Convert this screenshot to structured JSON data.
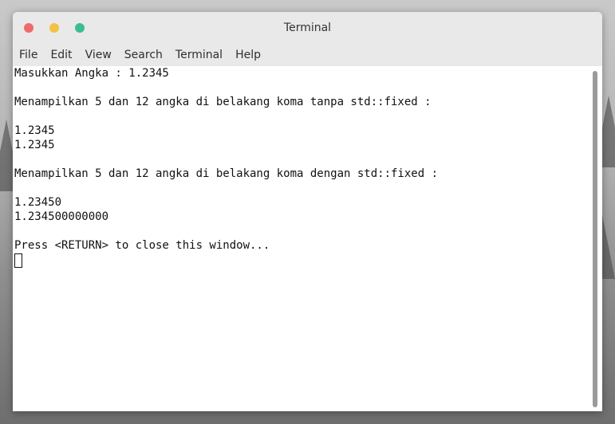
{
  "window": {
    "title": "Terminal"
  },
  "menu": {
    "items": [
      "File",
      "Edit",
      "View",
      "Search",
      "Terminal",
      "Help"
    ]
  },
  "terminal": {
    "lines": [
      "Masukkan Angka : 1.2345",
      "",
      "Menampilkan 5 dan 12 angka di belakang koma tanpa std::fixed :",
      "",
      "1.2345",
      "1.2345",
      "",
      "Menampilkan 5 dan 12 angka di belakang koma dengan std::fixed :",
      "",
      "1.23450",
      "1.234500000000",
      "",
      "Press <RETURN> to close this window..."
    ]
  },
  "icons": {
    "close": "close-icon",
    "minimize": "minimize-icon",
    "maximize": "maximize-icon"
  },
  "colors": {
    "close": "#ef6b6b",
    "minimize": "#f3c144",
    "maximize": "#3dbd8e",
    "titlebar": "#e9e9e9",
    "terminal_bg": "#ffffff",
    "terminal_fg": "#111111"
  }
}
